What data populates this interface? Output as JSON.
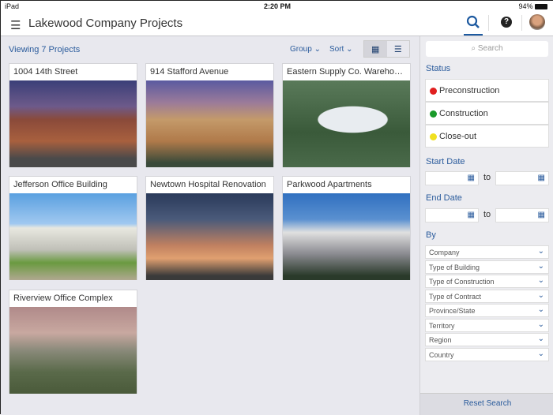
{
  "status": {
    "device": "iPad",
    "time": "2:20 PM",
    "battery": "94%"
  },
  "header": {
    "title": "Lakewood Company Projects"
  },
  "toolbar": {
    "viewing": "Viewing 7 Projects",
    "group": "Group ⌄",
    "sort": "Sort ⌄"
  },
  "projects": [
    {
      "name": "1004 14th Street"
    },
    {
      "name": "914 Stafford Avenue"
    },
    {
      "name": "Eastern Supply Co. Warehouse"
    },
    {
      "name": "Jefferson Office Building"
    },
    {
      "name": "Newtown Hospital Renovation"
    },
    {
      "name": "Parkwood Apartments"
    },
    {
      "name": "Riverview Office Complex"
    }
  ],
  "filters": {
    "search_placeholder": "Search",
    "status_label": "Status",
    "statuses": [
      {
        "label": "Preconstruction",
        "color": "#e02020"
      },
      {
        "label": "Construction",
        "color": "#1a9a2a"
      },
      {
        "label": "Close-out",
        "color": "#f0e020"
      }
    ],
    "start_date": "Start Date",
    "end_date": "End Date",
    "to": "to",
    "by": "By",
    "by_options": [
      "Company",
      "Type of Building",
      "Type of Construction",
      "Type of Contract",
      "Province/State",
      "Territory",
      "Region",
      "Country"
    ],
    "reset": "Reset Search"
  }
}
